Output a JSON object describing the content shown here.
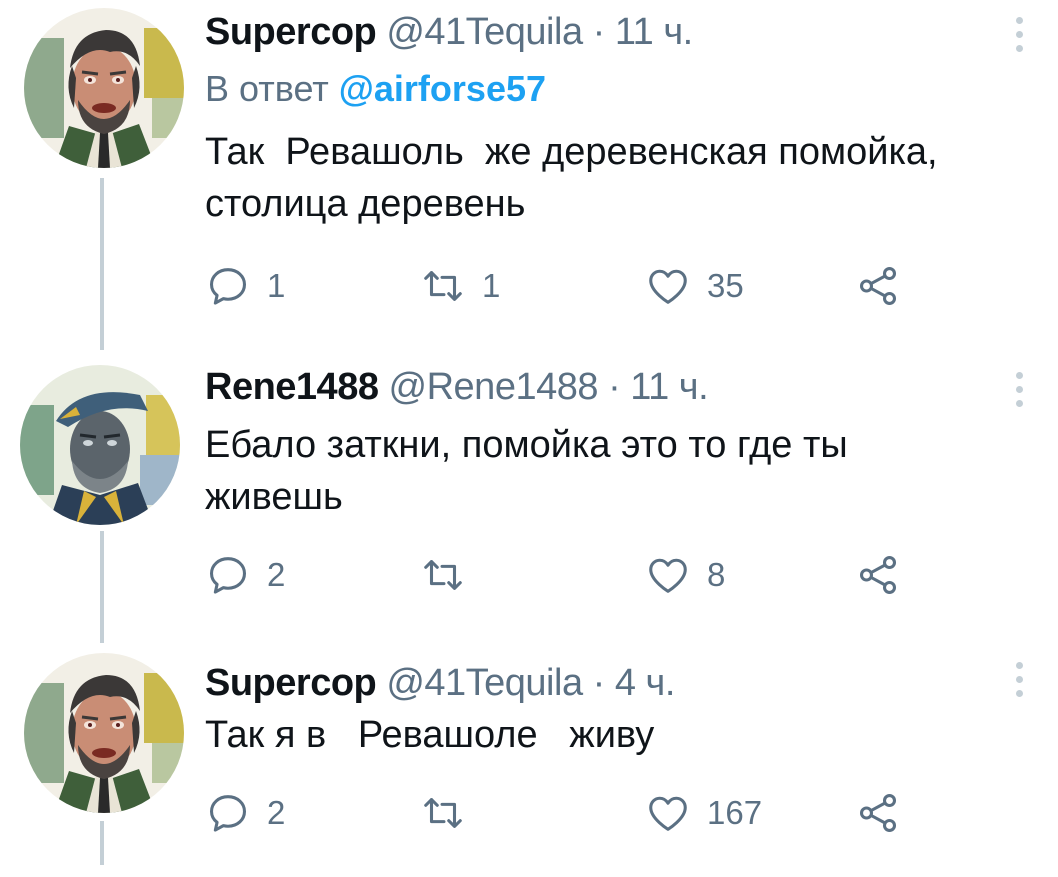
{
  "tweets": [
    {
      "name": "Supercop",
      "handle": "@41Tequila",
      "dot": "·",
      "time": "11 ч.",
      "reply_prefix": "В ответ",
      "reply_mention": "@airforse57",
      "text": "Так  Ревашоль  же деревенская помойка,\nстолица деревень",
      "replies": "1",
      "retweets": "1",
      "likes": "35"
    },
    {
      "name": "Rene1488",
      "handle": "@Rene1488",
      "dot": "·",
      "time": "11 ч.",
      "text": "Ебало заткни, помойка это то где ты\nживешь",
      "replies": "2",
      "retweets": "",
      "likes": "8"
    },
    {
      "name": "Supercop",
      "handle": "@41Tequila",
      "dot": "·",
      "time": "4 ч.",
      "text": "Так я в   Ревашоле   живу",
      "replies": "2",
      "retweets": "",
      "likes": "167"
    }
  ],
  "icons": {
    "reply": "reply-icon",
    "retweet": "retweet-icon",
    "like": "like-icon",
    "share": "share-icon",
    "more": "more-icon"
  },
  "colors": {
    "text": "#0f1419",
    "secondary": "#5b7083",
    "link": "#1da1f2",
    "thread_line": "#c4cfd6"
  }
}
